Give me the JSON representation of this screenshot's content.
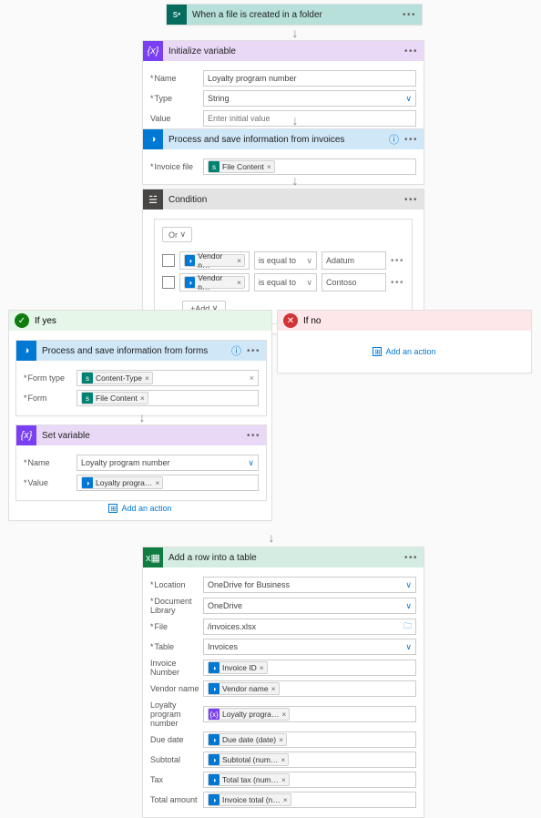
{
  "trigger": {
    "title": "When a file is created in a folder"
  },
  "init_var": {
    "title": "Initialize variable",
    "name_lbl": "Name",
    "name_val": "Loyalty program number",
    "type_lbl": "Type",
    "type_val": "String",
    "value_lbl": "Value",
    "value_ph": "Enter initial value"
  },
  "proc_inv": {
    "title": "Process and save information from invoices",
    "file_lbl": "Invoice file",
    "file_token": "File Content"
  },
  "condition": {
    "title": "Condition",
    "logic": "Or",
    "rows": [
      {
        "left": "Vendor n…",
        "op": "is equal to",
        "right": "Adatum"
      },
      {
        "left": "Vendor n…",
        "op": "is equal to",
        "right": "Contoso"
      }
    ],
    "add": "Add"
  },
  "yes": {
    "label": "If yes",
    "proc_forms": {
      "title": "Process and save information from  forms",
      "type_lbl": "Form type",
      "type_token": "Content-Type",
      "form_lbl": "Form",
      "form_token": "File Content"
    },
    "set_var": {
      "title": "Set variable",
      "name_lbl": "Name",
      "name_val": "Loyalty program number",
      "value_lbl": "Value",
      "value_token": "Loyalty progra…"
    },
    "add_action": "Add an action"
  },
  "no": {
    "label": "If no",
    "add_action": "Add an action"
  },
  "excel": {
    "title": "Add a row into a table",
    "loc_lbl": "Location",
    "loc_val": "OneDrive for Business",
    "lib_lbl": "Document Library",
    "lib_val": "OneDrive",
    "file_lbl": "File",
    "file_val": "/invoices.xlsx",
    "tbl_lbl": "Table",
    "tbl_val": "Invoices",
    "inv_lbl": "Invoice Number",
    "inv_tok": "Invoice ID",
    "ven_lbl": "Vendor name",
    "ven_tok": "Vendor name",
    "loy_lbl": "Loyalty program number",
    "loy_tok": "Loyalty progra…",
    "due_lbl": "Due date",
    "due_tok": "Due date (date)",
    "sub_lbl": "Subtotal",
    "sub_tok": "Subtotal (num…",
    "tax_lbl": "Tax",
    "tax_tok": "Total tax (num…",
    "tot_lbl": "Total amount",
    "tot_tok": "Invoice total (n…"
  }
}
